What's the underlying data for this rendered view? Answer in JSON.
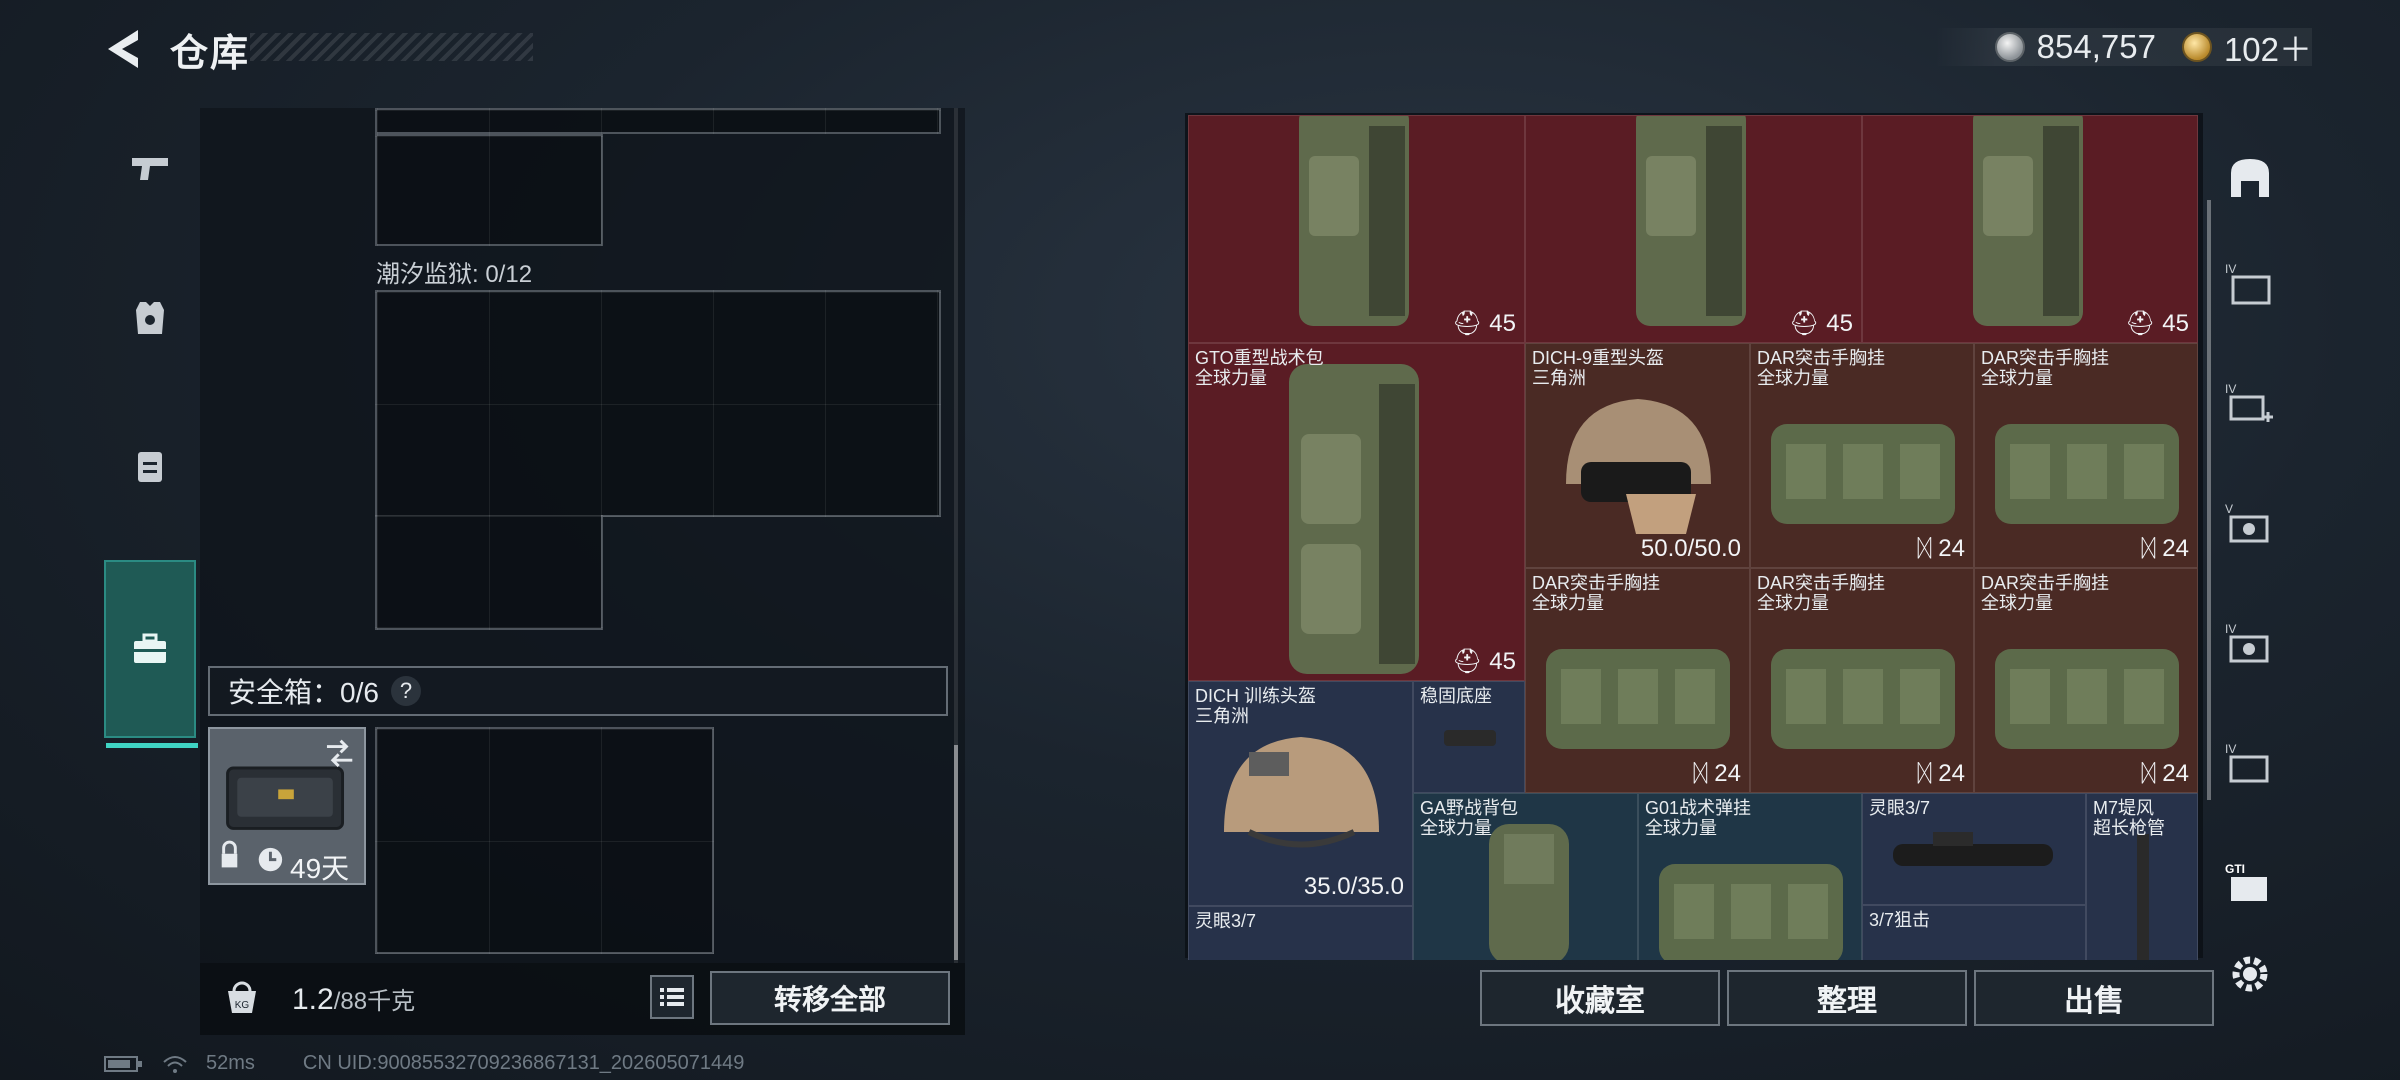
{
  "header": {
    "title": "仓库",
    "currency": [
      {
        "icon": "silver-coin-icon",
        "value": "854,757"
      },
      {
        "icon": "gold-coin-icon",
        "value": "102＋"
      }
    ]
  },
  "left_nav": [
    {
      "icon": "pistol-icon",
      "active": false
    },
    {
      "icon": "armor-vest-icon",
      "active": false
    },
    {
      "icon": "backpack-icon",
      "active": false
    },
    {
      "icon": "briefcase-icon",
      "active": true
    }
  ],
  "left_panel": {
    "container_label": "潮汐监狱: 0/12",
    "safebox_label": "安全箱：0/6",
    "safebox_help": "?",
    "safebox_timer": "49天",
    "weight_value": "1.2",
    "weight_max": "/88千克",
    "transfer_all": "转移全部"
  },
  "stash_items": [
    {
      "name": "",
      "sub": "",
      "count": "45",
      "count_icon": "helmet-icon",
      "color": "red"
    },
    {
      "name": "",
      "sub": "",
      "count": "45",
      "count_icon": "helmet-icon",
      "color": "red"
    },
    {
      "name": "",
      "sub": "",
      "count": "45",
      "count_icon": "helmet-icon",
      "color": "red"
    },
    {
      "name": "GTO重型战术包",
      "sub": "全球力量",
      "count": "45",
      "count_icon": "helmet-icon",
      "color": "red"
    },
    {
      "name": "DICH-9重型头盔",
      "sub": "三角洲",
      "durability": "50.0/50.0",
      "color": "brown"
    },
    {
      "name": "DAR突击手胸挂",
      "sub": "全球力量",
      "count": "24",
      "count_icon": "vest-icon",
      "color": "brown"
    },
    {
      "name": "DAR突击手胸挂",
      "sub": "全球力量",
      "count": "24",
      "count_icon": "vest-icon",
      "color": "brown"
    },
    {
      "name": "DAR突击手胸挂",
      "sub": "全球力量",
      "count": "24",
      "count_icon": "vest-icon",
      "color": "brown"
    },
    {
      "name": "DAR突击手胸挂",
      "sub": "全球力量",
      "count": "24",
      "count_icon": "vest-icon",
      "color": "brown"
    },
    {
      "name": "DAR突击手胸挂",
      "sub": "全球力量",
      "count": "24",
      "count_icon": "vest-icon",
      "color": "brown"
    },
    {
      "name": "DICH 训练头盔",
      "sub": "三角洲",
      "durability": "35.0/35.0",
      "color": "navy"
    },
    {
      "name": "稳固底座",
      "sub": "",
      "color": "navy"
    },
    {
      "name": "GA野战背包",
      "sub": "全球力量",
      "color": "blue"
    },
    {
      "name": "G01战术弹挂",
      "sub": "全球力量",
      "color": "blue"
    },
    {
      "name": "灵眼3/7",
      "sub": "",
      "color": "navy"
    },
    {
      "name": "M7堤风",
      "sub": "超长枪管",
      "color": "navy"
    },
    {
      "name": "灵眼3/7",
      "sub": "",
      "color": "navy"
    },
    {
      "name": "3/7狙击",
      "sub": "",
      "color": "navy"
    }
  ],
  "right_nav_icons": [
    "helmet-shelf-icon",
    "lvl4-folder-icon",
    "lvl4-add-icon",
    "lvl5-case-icon",
    "lvl4-case-icon",
    "lvl4-container-icon",
    "gti-container-icon",
    "settings-icon"
  ],
  "bottom_buttons": {
    "collection": "收藏室",
    "organize": "整理",
    "sell": "出售"
  },
  "footer": {
    "ping": "52ms",
    "uid": "CN UID:90085532709236867131_202605071449"
  }
}
